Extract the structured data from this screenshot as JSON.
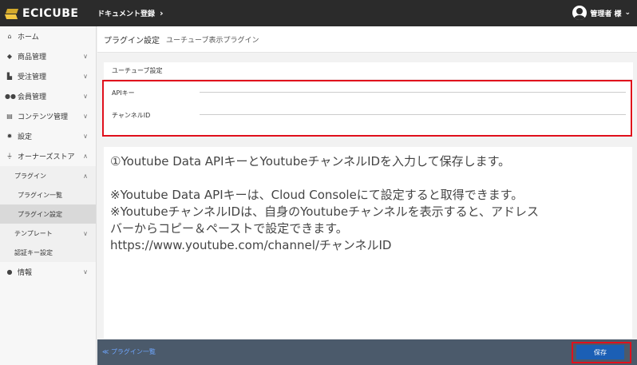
{
  "header": {
    "logo_text": "ECICUBE",
    "doc_link": "ドキュメント登録",
    "user_name": "管理者 様"
  },
  "sidebar": {
    "items": [
      {
        "label": "ホーム",
        "icon": "home-icon"
      },
      {
        "label": "商品管理",
        "icon": "cube-icon"
      },
      {
        "label": "受注管理",
        "icon": "cart-icon"
      },
      {
        "label": "会員管理",
        "icon": "users-icon"
      },
      {
        "label": "コンテンツ管理",
        "icon": "file-icon"
      },
      {
        "label": "設定",
        "icon": "gear-icon"
      },
      {
        "label": "オーナーズストア",
        "icon": "plug-icon"
      }
    ],
    "store_sub": {
      "plugin": "プラグイン",
      "plugin_list": "プラグイン一覧",
      "plugin_settings": "プラグイン設定",
      "template": "テンプレート",
      "auth_key": "認証キー設定"
    },
    "info": {
      "label": "情報",
      "icon": "info-icon"
    }
  },
  "page": {
    "title": "プラグイン設定",
    "subtitle": "ユーチューブ表示プラグイン"
  },
  "card": {
    "header": "ユーチューブ設定",
    "api_key_label": "APIキー",
    "channel_label": "チャンネルID",
    "api_key_value": "",
    "channel_value": ""
  },
  "info": {
    "line1": "①Youtube Data APIキーとYoutubeチャンネルIDを入力して保存します。",
    "line2": "※Youtube Data APIキーは、Cloud Consoleにて設定すると取得できます。",
    "line3": "※YoutubeチャンネルIDは、自身のYoutubeチャンネルを表示すると、アドレス",
    "line4": "バーからコピー＆ペーストで設定できます。",
    "line5": "https://www.youtube.com/channel/チャンネルID"
  },
  "footer": {
    "back_label": "≪ プラグイン一覧",
    "save_label": "保存"
  },
  "colors": {
    "header_bg": "#2b2b2b",
    "footer_bg": "#4b5a6b",
    "save_btn": "#1b5fb5",
    "highlight": "#e0101c"
  }
}
